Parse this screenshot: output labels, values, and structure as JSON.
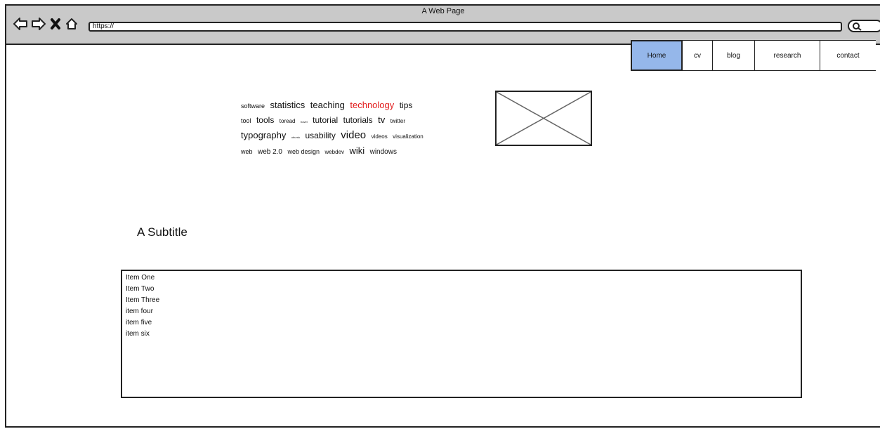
{
  "window": {
    "title": "A Web Page"
  },
  "browser": {
    "url": "https://"
  },
  "nav": {
    "tabs": [
      {
        "label": "Home",
        "active": true
      },
      {
        "label": "cv"
      },
      {
        "label": "blog"
      },
      {
        "label": "research"
      },
      {
        "label": "contact"
      }
    ]
  },
  "tagcloud": {
    "tags": [
      "software",
      "statistics",
      "teaching",
      "technology",
      "tips",
      "tool",
      "tools",
      "toread",
      "travel",
      "tutorial",
      "tutorials",
      "tv",
      "twitter",
      "typography",
      "ubuntu",
      "usability",
      "video",
      "videos",
      "visualization",
      "web",
      "web 2.0",
      "web design",
      "webdev",
      "wiki",
      "windows"
    ],
    "highlight_color": "#e21b1b"
  },
  "main": {
    "subtitle": "A Subtitle",
    "list": [
      "Item One",
      "Item Two",
      "Item Three",
      "item four",
      "item five",
      "item six"
    ]
  },
  "colors": {
    "active_tab": "#95b7ea",
    "titlebar": "#c9c9c9"
  }
}
